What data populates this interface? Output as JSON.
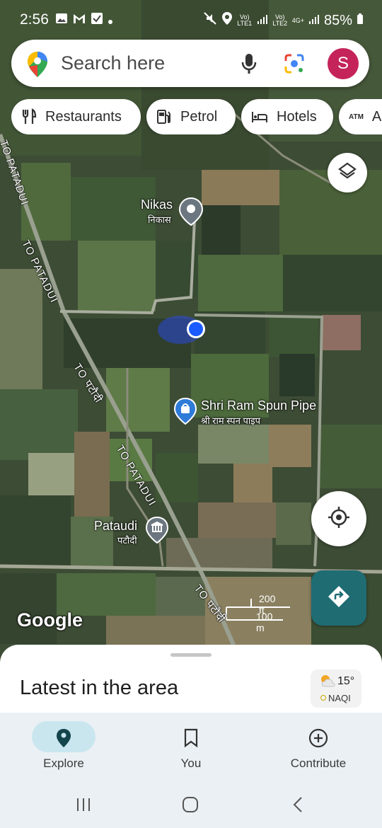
{
  "status_bar": {
    "time": "2:56",
    "battery": "85%",
    "sim1": "Vo) LTE1",
    "sim2": "Vo) LTE2",
    "net": "4G+"
  },
  "search": {
    "placeholder": "Search here",
    "avatar_letter": "S"
  },
  "chips": [
    {
      "label": "Restaurants",
      "icon": "fork-knife-icon"
    },
    {
      "label": "Petrol",
      "icon": "fuel-pump-icon"
    },
    {
      "label": "Hotels",
      "icon": "bed-icon"
    },
    {
      "label": "A",
      "icon": "atm-icon",
      "icon_text": "ATM"
    }
  ],
  "map": {
    "places": [
      {
        "name": "Nikas",
        "sub": "निकास"
      },
      {
        "name": "Shri Ram Spun Pipe",
        "sub": "श्री राम स्पन पाइप"
      },
      {
        "name": "Pataudi",
        "sub": "पटौदी"
      }
    ],
    "roads": [
      "TO PATADUI",
      "TO PATADUI",
      "TO पटौदी",
      "TO PATADUI",
      "TO पटौदी"
    ],
    "attribution": "Google",
    "scale": {
      "imperial": "200 ft",
      "metric": "100 m"
    }
  },
  "sheet": {
    "title": "Latest in the area",
    "weather": {
      "temp": "15°",
      "aqi": "NAQI"
    }
  },
  "bottom_nav": [
    {
      "label": "Explore",
      "active": true
    },
    {
      "label": "You",
      "active": false
    },
    {
      "label": "Contribute",
      "active": false
    }
  ],
  "colors": {
    "accent": "#1f6c73",
    "avatar": "#c4245a",
    "nav_bg": "#eaf0f4",
    "location_dot": "#1a5cff"
  }
}
